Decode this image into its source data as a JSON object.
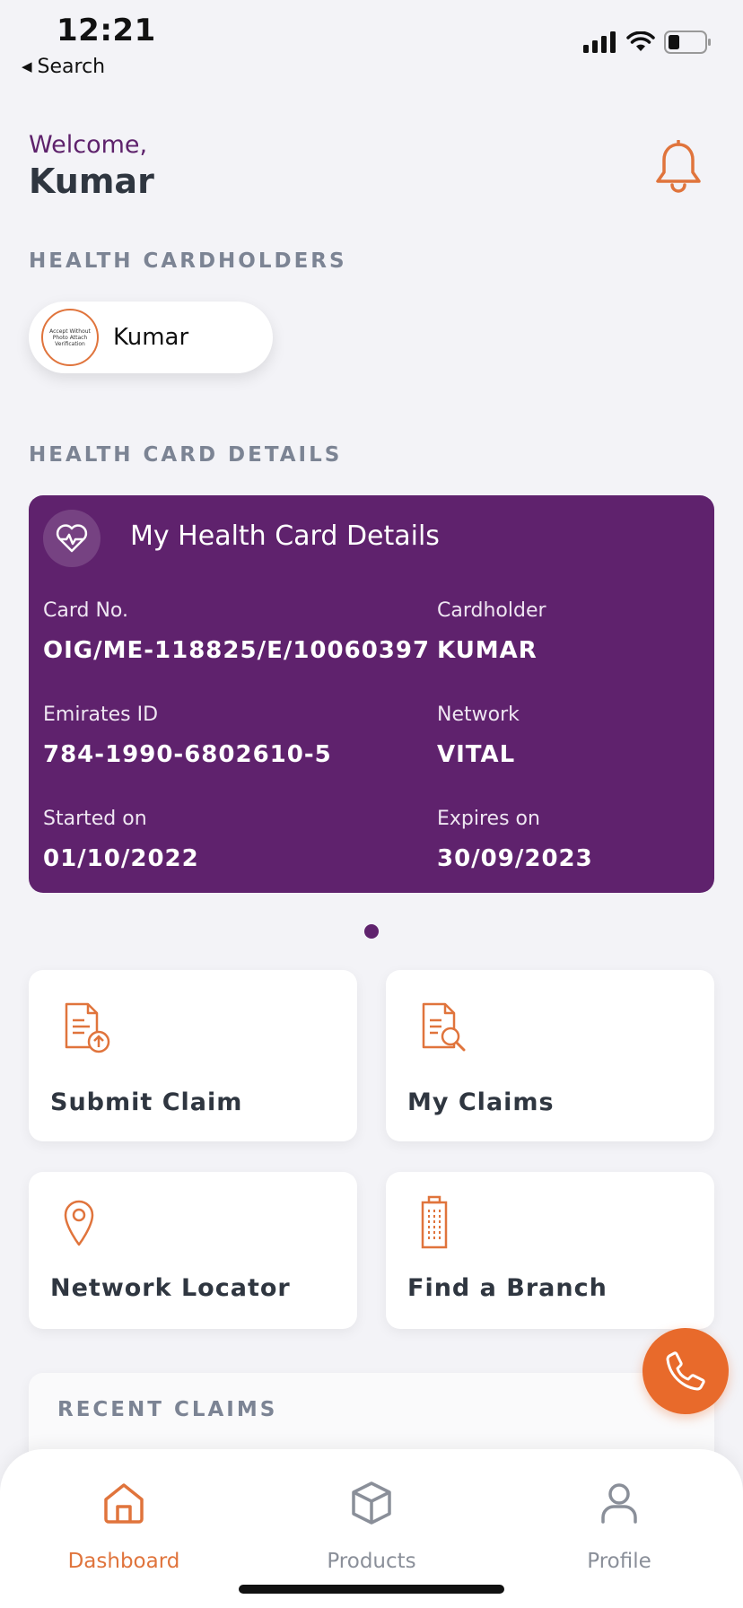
{
  "status_bar": {
    "time": "12:21",
    "back_label": "Search"
  },
  "header": {
    "welcome": "Welcome,",
    "name": "Kumar"
  },
  "cardholders": {
    "section_title": "HEALTH CARDHOLDERS",
    "items": [
      {
        "name": "Kumar",
        "avatar_text": "Accept Without Photo Attach Verification"
      }
    ]
  },
  "card_details": {
    "section_title": "HEALTH CARD DETAILS",
    "title": "My Health Card Details",
    "fields": {
      "card_no_label": "Card No.",
      "card_no": "OIG/ME-118825/E/10060397",
      "cardholder_label": "Cardholder",
      "cardholder": "KUMAR",
      "emirates_id_label": "Emirates ID",
      "emirates_id": "784-1990-6802610-5",
      "network_label": "Network",
      "network": "VITAL",
      "started_label": "Started on",
      "started": "01/10/2022",
      "expires_label": "Expires on",
      "expires": "30/09/2023"
    }
  },
  "tiles": {
    "submit_claim": "Submit Claim",
    "my_claims": "My Claims",
    "network_locator": "Network Locator",
    "find_branch": "Find a Branch"
  },
  "recent_claims": {
    "title": "RECENT CLAIMS"
  },
  "tabbar": {
    "tabs": [
      {
        "label": "Dashboard",
        "icon": "home-icon",
        "active": true
      },
      {
        "label": "Products",
        "icon": "box-icon",
        "active": false
      },
      {
        "label": "Profile",
        "icon": "person-icon",
        "active": false
      }
    ]
  },
  "colors": {
    "brand_purple": "#5f226d",
    "accent_orange": "#e86a2b",
    "background": "#f3f3f7"
  }
}
